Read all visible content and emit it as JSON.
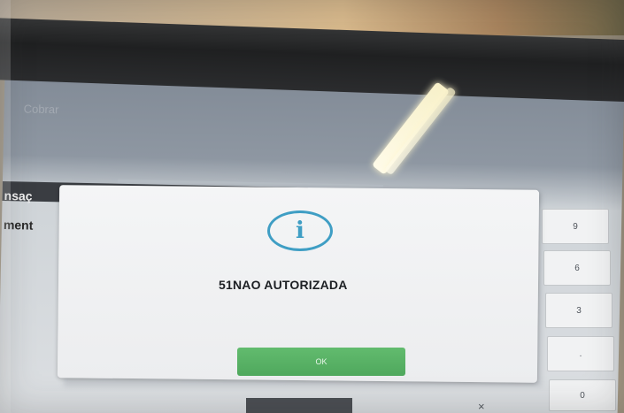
{
  "background_app": {
    "faint_header_label": "Cobrar",
    "tab_fragment": "nsaç",
    "side_label_fragment": "ment",
    "keypad": {
      "keys": [
        "9",
        "6",
        "3",
        ".",
        "0"
      ],
      "clear_key": "×"
    }
  },
  "dialog": {
    "icon": "info-icon",
    "icon_glyph": "i",
    "message": "51NAO AUTORIZADA",
    "ok_label": "OK"
  },
  "colors": {
    "info_accent": "#3f9ec4",
    "ok_button": "#55ad62",
    "dialog_bg": "#f1f2f3"
  }
}
